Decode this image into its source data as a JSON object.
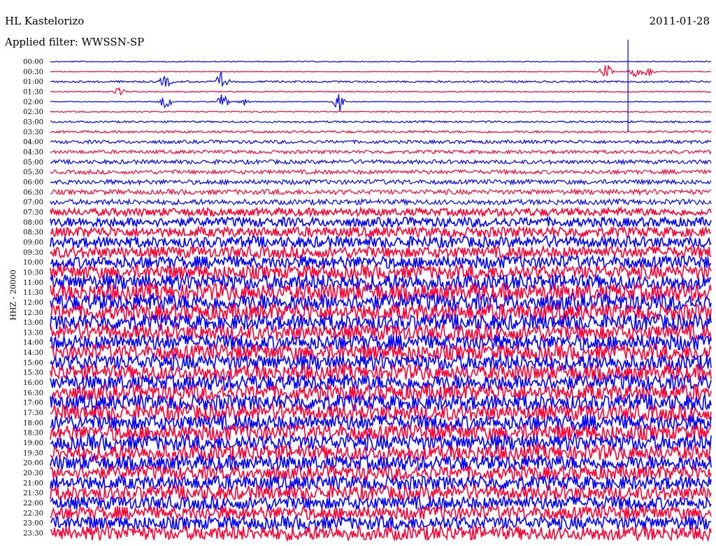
{
  "header": {
    "station": "HL Kastelorizo",
    "filter": "Applied filter: WWSSN-SP",
    "date": "2011-01-28"
  },
  "chart_data": {
    "type": "line",
    "title": "HL Kastelorizo",
    "subtitle": "Applied filter: WWSSN-SP",
    "date": "2011-01-28",
    "ylabel": "HHZ - 20000",
    "xlabel": "",
    "x_unit": "minutes within trace",
    "xlim": [
      0,
      30
    ],
    "colors": [
      "#0000ff",
      "#ff0033"
    ],
    "traces": [
      {
        "label": "00:00",
        "amp": 0.6
      },
      {
        "label": "00:30",
        "amp": 0.5
      },
      {
        "label": "01:00",
        "amp": 1.2
      },
      {
        "label": "01:30",
        "amp": 0.8
      },
      {
        "label": "02:00",
        "amp": 0.6
      },
      {
        "label": "02:30",
        "amp": 0.8
      },
      {
        "label": "03:00",
        "amp": 1.2
      },
      {
        "label": "03:30",
        "amp": 1.5
      },
      {
        "label": "04:00",
        "amp": 2.2
      },
      {
        "label": "04:30",
        "amp": 2.2
      },
      {
        "label": "05:00",
        "amp": 2.6
      },
      {
        "label": "05:30",
        "amp": 2.6
      },
      {
        "label": "06:00",
        "amp": 3
      },
      {
        "label": "06:30",
        "amp": 3.2
      },
      {
        "label": "07:00",
        "amp": 3.4
      },
      {
        "label": "07:30",
        "amp": 5
      },
      {
        "label": "08:00",
        "amp": 6
      },
      {
        "label": "08:30",
        "amp": 6.5
      },
      {
        "label": "09:00",
        "amp": 7
      },
      {
        "label": "09:30",
        "amp": 7.5
      },
      {
        "label": "10:00",
        "amp": 8
      },
      {
        "label": "10:30",
        "amp": 9
      },
      {
        "label": "11:00",
        "amp": 10
      },
      {
        "label": "11:30",
        "amp": 11
      },
      {
        "label": "12:00",
        "amp": 11
      },
      {
        "label": "12:30",
        "amp": 10.5
      },
      {
        "label": "13:00",
        "amp": 10
      },
      {
        "label": "13:30",
        "amp": 10
      },
      {
        "label": "14:00",
        "amp": 10
      },
      {
        "label": "14:30",
        "amp": 10
      },
      {
        "label": "15:00",
        "amp": 10
      },
      {
        "label": "15:30",
        "amp": 10
      },
      {
        "label": "16:00",
        "amp": 10
      },
      {
        "label": "16:30",
        "amp": 10
      },
      {
        "label": "17:00",
        "amp": 10
      },
      {
        "label": "17:30",
        "amp": 10
      },
      {
        "label": "18:00",
        "amp": 10
      },
      {
        "label": "18:30",
        "amp": 10
      },
      {
        "label": "19:00",
        "amp": 10
      },
      {
        "label": "19:30",
        "amp": 10
      },
      {
        "label": "20:00",
        "amp": 9.5
      },
      {
        "label": "20:30",
        "amp": 9
      },
      {
        "label": "21:00",
        "amp": 9
      },
      {
        "label": "21:30",
        "amp": 9
      },
      {
        "label": "22:00",
        "amp": 8.5
      },
      {
        "label": "22:30",
        "amp": 8.5
      },
      {
        "label": "23:00",
        "amp": 8.5
      },
      {
        "label": "23:30",
        "amp": 9
      }
    ],
    "events": [
      {
        "trace": 1,
        "minute": 25.2,
        "amp": 12
      },
      {
        "trace": 1,
        "minute": 26.5,
        "amp": 8
      },
      {
        "trace": 1,
        "minute": 27.1,
        "amp": 7
      },
      {
        "trace": 2,
        "minute": 5.2,
        "amp": 8
      },
      {
        "trace": 2,
        "minute": 7.8,
        "amp": 14
      },
      {
        "trace": 3,
        "minute": 3.1,
        "amp": 5
      },
      {
        "trace": 4,
        "minute": 5.2,
        "amp": 14
      },
      {
        "trace": 4,
        "minute": 7.8,
        "amp": 12
      },
      {
        "trace": 4,
        "minute": 8.8,
        "amp": 6
      },
      {
        "trace": 4,
        "minute": 13.1,
        "amp": 14
      },
      {
        "trace": 2,
        "minute": 26.2,
        "amp": 60
      }
    ]
  }
}
